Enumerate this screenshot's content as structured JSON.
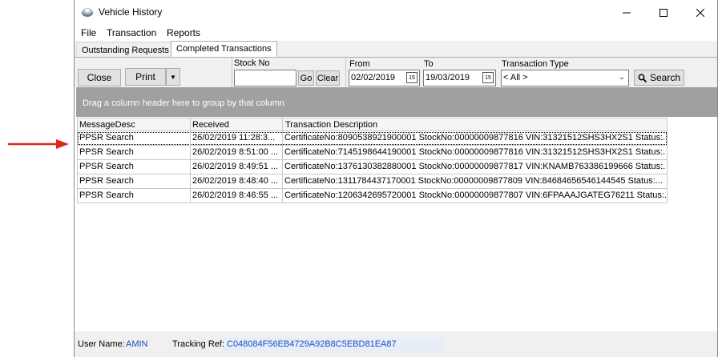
{
  "window": {
    "title": "Vehicle History",
    "min_icon": "minimize-icon",
    "max_icon": "maximize-icon",
    "close_icon": "close-icon"
  },
  "menu": {
    "items": [
      "File",
      "Transaction",
      "Reports"
    ]
  },
  "tabs": [
    {
      "label": "Outstanding Requests"
    },
    {
      "label": "Completed Transactions",
      "active": true
    }
  ],
  "toolbar": {
    "close_label": "Close",
    "print_label": "Print",
    "stock_label": "Stock No",
    "stock_value": "",
    "go_label": "Go",
    "clear_label": "Clear",
    "from_label": "From",
    "from_value": "02/02/2019",
    "to_label": "To",
    "to_value": "19/03/2019",
    "type_label": "Transaction Type",
    "type_value": "< All >",
    "search_label": "Search"
  },
  "grid": {
    "group_hint": "Drag a column header here to group by that column",
    "columns": [
      "MessageDesc",
      "Received",
      "Transaction Description"
    ],
    "rows": [
      [
        "PPSR Search",
        "26/02/2019 11:28:3...",
        "CertificateNo:8090538921900001 StockNo:00000009877816  VIN:31321512SHS3HX2S1 Status:..."
      ],
      [
        "PPSR Search",
        "26/02/2019 8:51:00 ...",
        "CertificateNo:7145198644190001 StockNo:00000009877816  VIN:31321512SHS3HX2S1 Status:..."
      ],
      [
        "PPSR Search",
        "26/02/2019 8:49:51 ...",
        "CertificateNo:1376130382880001 StockNo:00000009877817  VIN:KNAMB763386199666 Status:..."
      ],
      [
        "PPSR Search",
        "26/02/2019 8:48:40 ...",
        "CertificateNo:1311784437170001 StockNo:00000009877809  VIN:84684656546144545 Status:..."
      ],
      [
        "PPSR Search",
        "26/02/2019 8:46:55 ...",
        "CertificateNo:1206342695720001 StockNo:00000009877807  VIN:6FPAAAJGATEG76211 Status:..."
      ]
    ]
  },
  "status": {
    "user_label": "User Name:",
    "user_value": "AMIN",
    "tracking_label": "Tracking Ref:",
    "tracking_value": "C048084F56EB4729A92B8C5EBD81EA87"
  },
  "colors": {
    "arrow": "#e0261b",
    "status_value": "#1a4fc4",
    "group_panel": "#a0a0a0"
  }
}
